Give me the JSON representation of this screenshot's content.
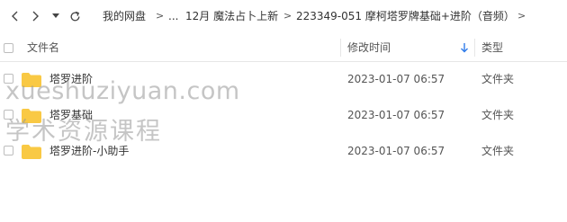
{
  "nav": {
    "back_icon": "chevron-left",
    "forward_icon": "chevron-right",
    "dropdown_icon": "caret-down",
    "refresh_icon": "refresh",
    "separator": ">",
    "breadcrumbs": [
      "我的网盘",
      "...",
      "12月 魔法占卜上新",
      "223349-051 摩柯塔罗牌基础+进阶（音频）"
    ]
  },
  "table": {
    "headers": {
      "name": "文件名",
      "modified": "修改时间",
      "type": "类型"
    },
    "sort_icon": "arrow-down",
    "rows": [
      {
        "name": "塔罗进阶",
        "modified": "2023-01-07 06:57",
        "type": "文件夹"
      },
      {
        "name": "塔罗基础",
        "modified": "2023-01-07 06:57",
        "type": "文件夹"
      },
      {
        "name": "塔罗进阶-小助手",
        "modified": "2023-01-07 06:57",
        "type": "文件夹"
      }
    ]
  },
  "watermark": {
    "line1": "xueshuziyuan.com",
    "line2": "学术资源课程"
  },
  "colors": {
    "folder": "#F9C944",
    "sort_arrow": "#2F7BEA",
    "divider": "#E6E6E6"
  }
}
